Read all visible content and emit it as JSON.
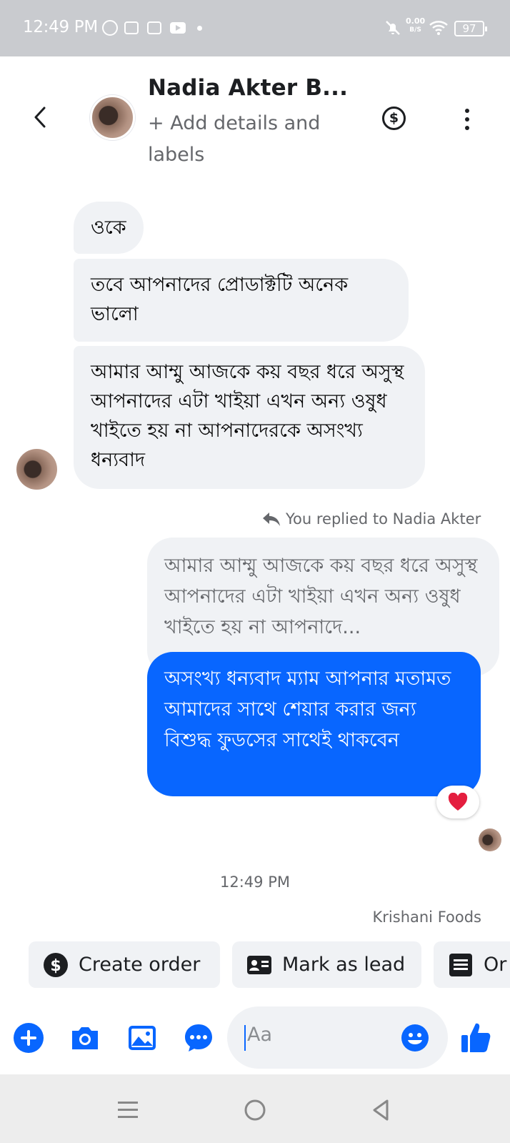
{
  "status_bar": {
    "time": "12:49 PM",
    "net_speed": "0.00",
    "net_unit": "B/S",
    "battery": "97",
    "icons": [
      "sync-icon",
      "app-icon",
      "photo-icon",
      "youtube-icon",
      "dot-icon",
      "mute-icon",
      "wifi-icon",
      "battery-icon"
    ]
  },
  "header": {
    "name": "Nadia Akter B...",
    "subtitle": "+ Add details and labels"
  },
  "messages": {
    "incoming": [
      "ওকে",
      "তবে আপনাদের প্রোডাক্টটি অনেক ভালো",
      "আমার আম্মু আজকে কয় বছর ধরে অসুস্থ আপনাদের এটা খাইয়া এখন অন্য ওষুধ খাইতে হয় না আপনাদেরকে অসংখ্য ধন্যবাদ"
    ],
    "reply_note": "You replied to Nadia Akter",
    "quoted": "আমার আম্মু আজকে কয় বছর ধরে অসুস্থ আপনাদের এটা খাইয়া এখন অন্য ওষুধ খাইতে হয় না আপনাদে...",
    "outgoing": "অসংখ্য ধন্যবাদ ম্যাম আপনার মতামত আমাদের সাথে শেয়ার করার জন্য বিশুদ্ধ ফুডসের সাথেই থাকবেন",
    "reaction": "heart-icon",
    "timestamp": "12:49 PM",
    "sender": "Krishani Foods"
  },
  "quick_actions": [
    "Create order",
    "Mark as lead",
    "Or"
  ],
  "composer": {
    "placeholder": "Aa"
  },
  "colors": {
    "accent": "#0866ff",
    "bubble_incoming": "#f0f2f5",
    "heart": "#e41e3f"
  }
}
